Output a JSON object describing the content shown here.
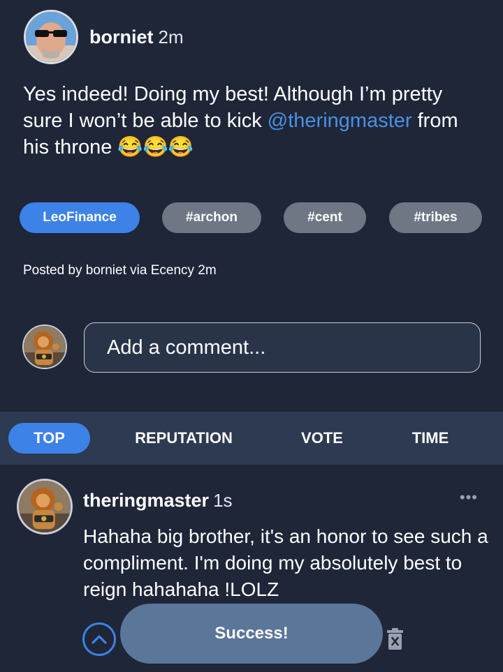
{
  "post": {
    "author": "borniet",
    "time": "2m",
    "body_parts": [
      "Yes indeed! Doing my best! Although I’m pretty sure I won’t be able to kick ",
      "@theringmaster",
      " from his throne ",
      "😂😂😂"
    ],
    "tags": [
      "LeoFinance",
      "#archon",
      "#cent",
      "#tribes"
    ],
    "posted_by": "Posted by borniet via Ecency 2m"
  },
  "composer": {
    "placeholder": "Add a comment..."
  },
  "sort_tabs": {
    "active": "TOP",
    "labels": [
      "TOP",
      "REPUTATION",
      "VOTE",
      "TIME"
    ]
  },
  "comment": {
    "author": "theringmaster",
    "time": "1s",
    "more": "•••",
    "body": "Hahaha big brother, it's an honor to see such a compliment. I'm doing my absolutely best to reign hahahaha !LOLZ"
  },
  "toast": {
    "message": "Success!"
  },
  "icons": {
    "author_avatar": "avatar-photo-icon",
    "my_avatar": "avatar-lion-icon",
    "upvote": "chevron-up-icon",
    "more": "more-dots-icon",
    "delete": "trash-icon"
  },
  "colors": {
    "background": "#1f2638",
    "accent": "#3d82e6",
    "mention": "#4a90e2",
    "tag_gray": "#6f7784",
    "sort_bar": "#2d3a52",
    "toast": "#5a7699"
  }
}
